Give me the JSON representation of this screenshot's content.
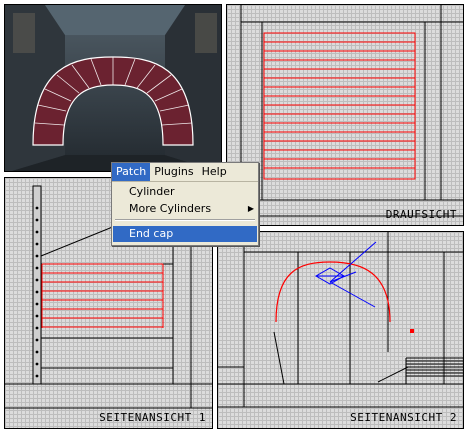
{
  "menu": {
    "bar": [
      "Patch",
      "Plugins",
      "Help"
    ],
    "items": [
      {
        "label": "Cylinder",
        "has_submenu": false
      },
      {
        "label": "More Cylinders",
        "has_submenu": true
      },
      {
        "label": "End cap",
        "has_submenu": false
      }
    ],
    "arrow_glyph": "▶"
  },
  "views": {
    "top": {
      "label": "DRAUFSICHT"
    },
    "side1": {
      "label": "SEITENANSICHT 1"
    },
    "side2": {
      "label": "SEITENANSICHT 2"
    }
  },
  "colors": {
    "patch_red": "#ff0000",
    "selection_blue": "#316ac5",
    "gizmo_blue": "#0000ff"
  }
}
